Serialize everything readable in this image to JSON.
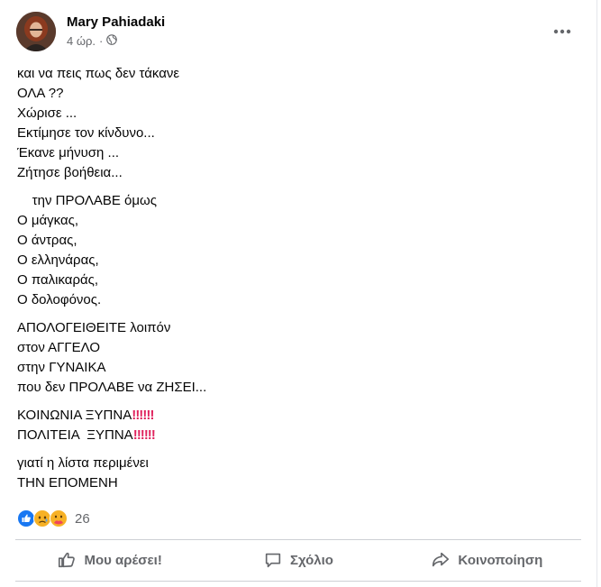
{
  "post": {
    "author": "Mary Pahiadaki",
    "time": "4 ώρ.",
    "separator": "·",
    "privacy_icon": "globe-icon",
    "more_icon": "more-options-icon",
    "paragraphs": [
      [
        "και να πεις πως δεν τάκανε",
        "ΟΛΑ ??",
        "Χώρισε ...",
        "Εκτίμησε τον κίνδυνο...",
        "Έκανε μήνυση ...",
        "Ζήτησε βοήθεια..."
      ],
      [
        "    την ΠΡΟΛΑΒΕ όμως",
        "Ο μάγκας,",
        "Ο άντρας,",
        "Ο ελληνάρας,",
        "Ο παλικαράς,",
        "Ο δολοφόνος."
      ],
      [
        "ΑΠΟΛΟΓΕΙΘΕΙΤΕ λοιπόν",
        "στον ΑΓΓΕΛΟ",
        "στην ΓΥΝΑΙΚΑ",
        "που δεν ΠΡΟΛΑΒΕ να ΖΗΣΕΙ..."
      ],
      [
        "ΚΟΙΝΩΝΙΑ ΞΥΠΝΑ",
        "ΠΟΛΙΤΕΙΑ  ΞΥΠΝΑ"
      ],
      [
        "γιατί η λίστα περιμένει",
        "ΤΗΝ ΕΠΟΜΕΝΗ"
      ]
    ],
    "emphasis": "‼‼‼"
  },
  "reactions": {
    "icons": [
      "like-reaction-icon",
      "sad-reaction-icon",
      "care-reaction-icon"
    ],
    "count": "26"
  },
  "actions": {
    "like": "Μου αρέσει!",
    "comment": "Σχόλιο",
    "share": "Κοινοποίηση"
  },
  "colors": {
    "like_blue": "#1877f2",
    "sad_yellow": "#f7b125",
    "text_secondary": "#65676b",
    "emphasis_red": "#e0245e"
  }
}
